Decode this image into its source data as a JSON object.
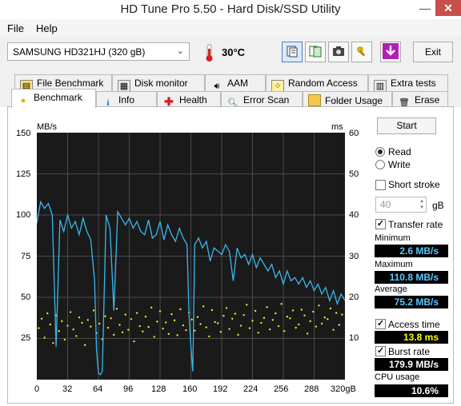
{
  "window": {
    "title": "HD Tune Pro 5.50 - Hard Disk/SSD Utility",
    "minimize": "—",
    "close": "✕"
  },
  "menu": {
    "file": "File",
    "help": "Help"
  },
  "toolbar": {
    "drive": "SAMSUNG HD321HJ (320 gB)",
    "temperature": "30°C",
    "exit": "Exit"
  },
  "tabs_top": [
    "File Benchmark",
    "Disk monitor",
    "AAM",
    "Random Access",
    "Extra tests"
  ],
  "tabs_bottom": [
    "Benchmark",
    "Info",
    "Health",
    "Error Scan",
    "Folder Usage",
    "Erase"
  ],
  "panel": {
    "start": "Start",
    "read": "Read",
    "write": "Write",
    "short_stroke": "Short stroke",
    "short_stroke_value": "40",
    "gb": "gB",
    "transfer_rate": "Transfer rate",
    "minimum_label": "Minimum",
    "minimum": "2.6 MB/s",
    "maximum_label": "Maximum",
    "maximum": "110.8 MB/s",
    "average_label": "Average",
    "average": "75.2 MB/s",
    "access_time_label": "Access time",
    "access_time": "13.8 ms",
    "burst_rate_label": "Burst rate",
    "burst_rate": "179.9 MB/s",
    "cpu_label": "CPU usage",
    "cpu": "10.6%"
  },
  "colors": {
    "plot_bg": "#1a1a1a",
    "grid": "#4a4a4a",
    "transfer_line": "#39b8ee",
    "access_points": "#e8e830"
  },
  "chart_data": {
    "type": "line",
    "left_axis_unit": "MB/s",
    "right_axis_unit": "ms",
    "x_ticks": [
      "0",
      "32",
      "64",
      "96",
      "128",
      "160",
      "192",
      "224",
      "256",
      "288",
      "320gB"
    ],
    "y_left_ticks": [
      "150",
      "125",
      "100",
      "75",
      "50",
      "25"
    ],
    "y_right_ticks": [
      "60",
      "50",
      "40",
      "30",
      "20",
      "10"
    ],
    "xlim": [
      0,
      320
    ],
    "ylim_left": [
      0,
      150
    ],
    "ylim_right": [
      0,
      60
    ],
    "grid": true,
    "series": [
      {
        "name": "Transfer rate",
        "x": [
          0,
          4,
          8,
          12,
          16,
          20,
          24,
          28,
          32,
          36,
          40,
          44,
          48,
          52,
          56,
          60,
          62,
          64,
          66,
          68,
          72,
          76,
          80,
          84,
          88,
          92,
          96,
          100,
          104,
          108,
          112,
          116,
          120,
          124,
          128,
          132,
          136,
          140,
          144,
          148,
          152,
          156,
          158,
          160,
          162,
          164,
          168,
          172,
          176,
          180,
          184,
          188,
          192,
          196,
          200,
          204,
          208,
          212,
          216,
          220,
          224,
          228,
          232,
          236,
          240,
          244,
          248,
          252,
          256,
          260,
          264,
          268,
          272,
          276,
          280,
          284,
          288,
          292,
          296,
          300,
          304,
          308,
          312,
          316,
          320
        ],
        "y": [
          95,
          108,
          104,
          107,
          100,
          20,
          97,
          90,
          100,
          92,
          96,
          88,
          98,
          90,
          85,
          60,
          18,
          4,
          3,
          5,
          100,
          92,
          42,
          102,
          98,
          94,
          98,
          92,
          96,
          90,
          88,
          97,
          86,
          88,
          96,
          85,
          94,
          88,
          84,
          92,
          86,
          82,
          40,
          20,
          5,
          82,
          86,
          80,
          84,
          72,
          80,
          78,
          76,
          82,
          78,
          60,
          80,
          74,
          76,
          70,
          76,
          68,
          74,
          70,
          66,
          70,
          62,
          66,
          58,
          66,
          60,
          62,
          58,
          62,
          56,
          60,
          54,
          58,
          52,
          56,
          48,
          54,
          46,
          52,
          48
        ]
      },
      {
        "name": "Access time",
        "x": [
          2,
          5,
          8,
          11,
          14,
          17,
          20,
          23,
          26,
          29,
          32,
          35,
          38,
          41,
          44,
          47,
          50,
          53,
          56,
          59,
          62,
          65,
          68,
          71,
          74,
          77,
          80,
          83,
          86,
          89,
          92,
          95,
          98,
          101,
          104,
          107,
          110,
          113,
          116,
          119,
          122,
          125,
          128,
          131,
          134,
          137,
          140,
          143,
          146,
          149,
          152,
          155,
          158,
          161,
          164,
          167,
          170,
          173,
          176,
          179,
          182,
          185,
          188,
          191,
          194,
          197,
          200,
          203,
          206,
          209,
          212,
          215,
          218,
          221,
          224,
          227,
          230,
          233,
          236,
          239,
          242,
          245,
          248,
          251,
          254,
          257,
          260,
          263,
          266,
          269,
          272,
          275,
          278,
          281,
          284,
          287,
          290,
          293,
          296,
          299,
          302,
          305,
          308,
          311,
          314,
          317
        ],
        "y": [
          12.5,
          14.8,
          10.2,
          16.1,
          13.4,
          8.9,
          15.6,
          11.8,
          14.2,
          9.7,
          13.1,
          16.4,
          12.2,
          10.6,
          15.1,
          13.8,
          8.4,
          14.5,
          12.9,
          16.8,
          11.3,
          13.6,
          9.8,
          15.4,
          12.6,
          14.9,
          10.9,
          17.2,
          13.3,
          11.5,
          15.8,
          12.1,
          14.7,
          9.3,
          16.2,
          13.0,
          11.7,
          15.3,
          12.8,
          17.5,
          10.4,
          14.1,
          16.6,
          12.4,
          13.9,
          11.1,
          15.9,
          14.4,
          10.8,
          17.1,
          13.2,
          12.0,
          16.3,
          14.6,
          11.9,
          15.2,
          13.5,
          17.8,
          12.7,
          10.5,
          16.9,
          14.0,
          13.7,
          11.6,
          15.5,
          17.4,
          12.3,
          14.8,
          16.0,
          10.9,
          13.1,
          15.7,
          18.2,
          12.5,
          14.3,
          16.7,
          11.4,
          13.8,
          15.0,
          17.6,
          12.2,
          14.5,
          16.1,
          13.0,
          18.4,
          11.8,
          15.3,
          14.9,
          16.8,
          12.6,
          13.4,
          17.0,
          15.6,
          11.2,
          14.2,
          16.5,
          12.9,
          18.0,
          13.6,
          15.1,
          14.7,
          17.3,
          12.1,
          16.2,
          13.3,
          15.8
        ]
      }
    ]
  }
}
